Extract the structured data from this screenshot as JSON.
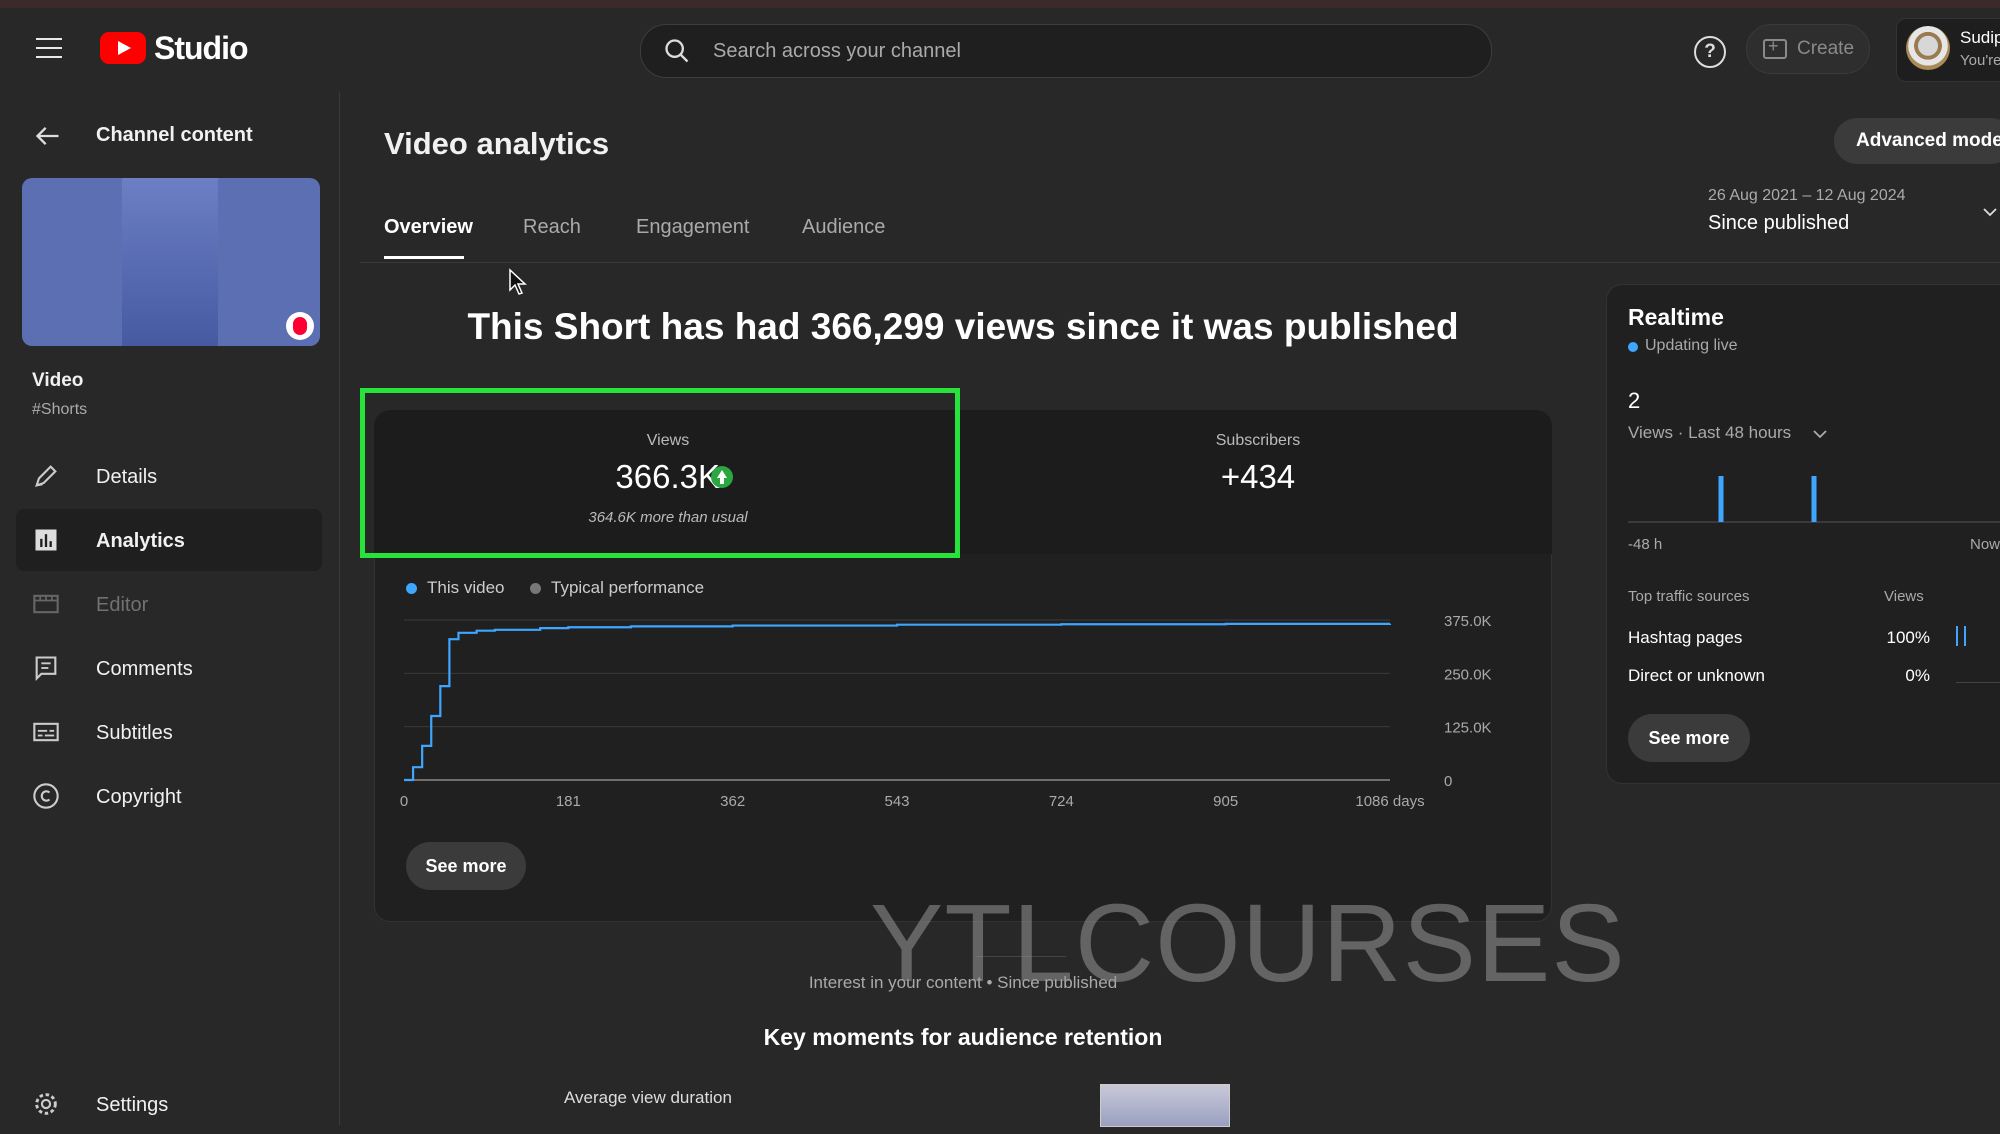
{
  "topbar": {
    "brand": "Studio",
    "search_placeholder": "Search across your channel",
    "create_label": "Create",
    "account_name": "Sudip",
    "account_sub": "You're"
  },
  "sidebar": {
    "back_label": "Channel content",
    "video_title": "Video",
    "video_tag": "#Shorts",
    "items": [
      {
        "label": "Details",
        "icon": "pencil-icon"
      },
      {
        "label": "Analytics",
        "icon": "analytics-icon"
      },
      {
        "label": "Editor",
        "icon": "editor-icon"
      },
      {
        "label": "Comments",
        "icon": "comments-icon"
      },
      {
        "label": "Subtitles",
        "icon": "subtitles-icon"
      },
      {
        "label": "Copyright",
        "icon": "copyright-icon"
      },
      {
        "label": "Settings",
        "icon": "gear-icon"
      }
    ]
  },
  "main": {
    "title": "Video analytics",
    "advanced_mode": "Advanced mode",
    "tabs": [
      "Overview",
      "Reach",
      "Engagement",
      "Audience"
    ],
    "date_range": "26 Aug 2021 – 12 Aug 2024",
    "date_period": "Since published",
    "headline": "This Short has had 366,299 views since it was published",
    "metrics": {
      "views_label": "Views",
      "views_value": "366.3K",
      "views_note": "364.6K more than usual",
      "subs_label": "Subscribers",
      "subs_value": "+434"
    },
    "legend": {
      "this_video": "This video",
      "typical": "Typical performance"
    },
    "see_more": "See more",
    "interest": "Interest in your content • Since published",
    "key_moments": "Key moments for audience retention",
    "avg_view_duration": "Average view duration"
  },
  "chart_data": {
    "type": "line",
    "series": [
      {
        "name": "This video",
        "color": "#3ea6ff"
      }
    ],
    "x": [
      0,
      10,
      20,
      30,
      40,
      50,
      60,
      80,
      100,
      150,
      181,
      250,
      362,
      543,
      724,
      905,
      1086
    ],
    "y": [
      0,
      30000,
      80000,
      150000,
      220000,
      330000,
      345000,
      350000,
      352000,
      356000,
      358000,
      360000,
      362000,
      364000,
      365000,
      366000,
      366299
    ],
    "x_ticks": [
      "0",
      "181",
      "362",
      "543",
      "724",
      "905",
      "1086 days"
    ],
    "y_ticks": [
      "0",
      "125.0K",
      "250.0K",
      "375.0K"
    ],
    "xlim": [
      0,
      1086
    ],
    "ylim": [
      0,
      375000
    ],
    "grid": true
  },
  "realtime": {
    "title": "Realtime",
    "live": "Updating live",
    "count": "2",
    "desc": "Views · Last 48 hours",
    "axis_left": "-48 h",
    "axis_right": "Now",
    "spark": [
      {
        "hour": -36,
        "value": 1
      },
      {
        "hour": -24,
        "value": 1
      }
    ],
    "traffic_head": "Top traffic sources",
    "traffic_views_head": "Views",
    "sources": [
      {
        "name": "Hashtag pages",
        "pct": "100%"
      },
      {
        "name": "Direct or unknown",
        "pct": "0%"
      }
    ],
    "see_more": "See more"
  },
  "watermark": "YTLCOURSES",
  "colors": {
    "accent": "#3ea6ff",
    "highlight": "#27e33b",
    "brand_red": "#ff0000",
    "up_green": "#2ba640"
  }
}
